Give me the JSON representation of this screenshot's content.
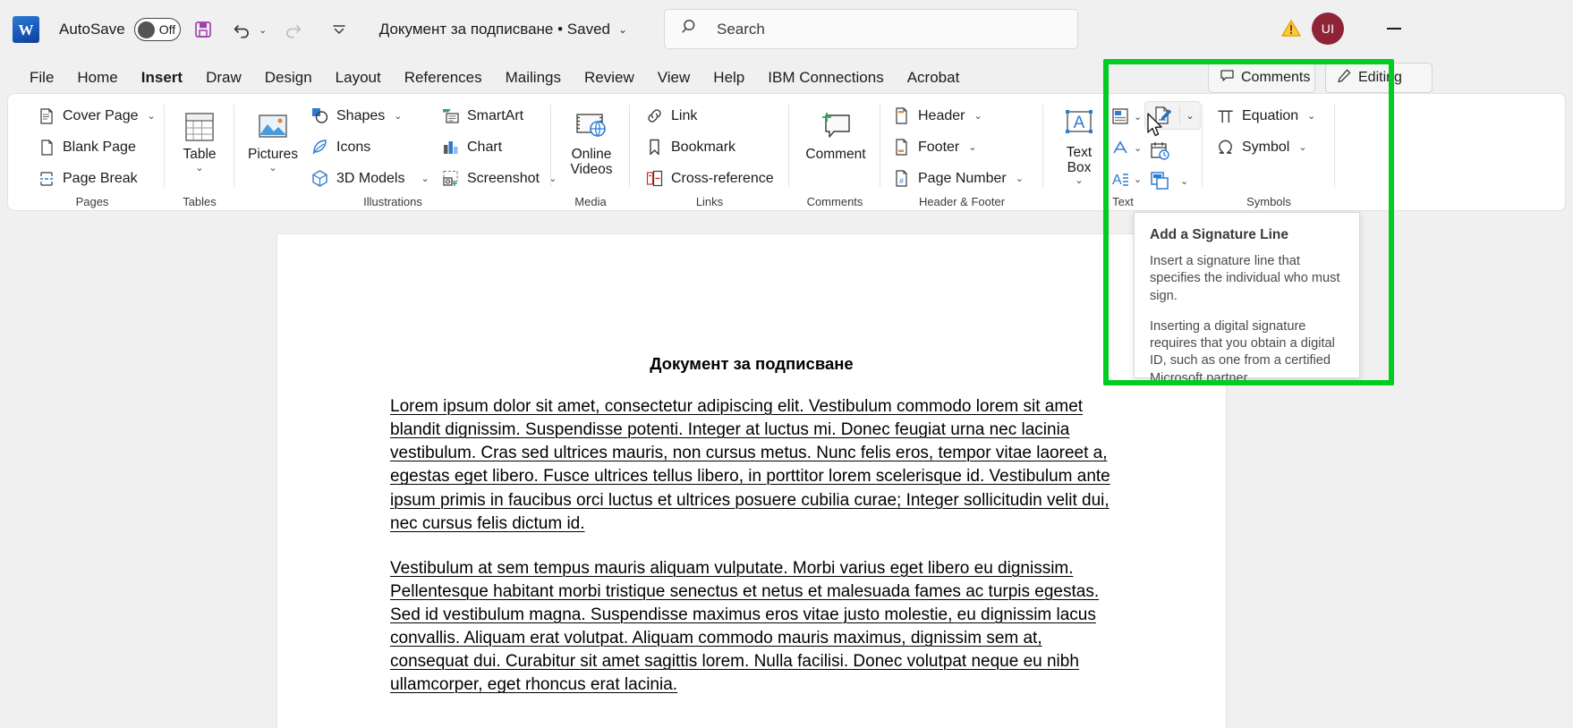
{
  "titlebar": {
    "logo_text": "W",
    "autosave_label": "AutoSave",
    "autosave_state": "Off",
    "save_icon": "save-icon",
    "undo_icon": "undo-icon",
    "redo_icon": "redo-icon",
    "customize_icon": "customize-quick-access-toolbar-icon",
    "document_title": "Документ за подписване • Saved",
    "title_caret": "⌄",
    "warning_icon": "warning-triangle-icon",
    "avatar_initials": "UI",
    "avatar_color": "#8f2439",
    "minimize_label": "—"
  },
  "search": {
    "icon": "search-icon",
    "placeholder": "Search"
  },
  "tabs": [
    {
      "label": "File",
      "active": false
    },
    {
      "label": "Home",
      "active": false
    },
    {
      "label": "Insert",
      "active": true
    },
    {
      "label": "Draw",
      "active": false
    },
    {
      "label": "Design",
      "active": false
    },
    {
      "label": "Layout",
      "active": false
    },
    {
      "label": "References",
      "active": false
    },
    {
      "label": "Mailings",
      "active": false
    },
    {
      "label": "Review",
      "active": false
    },
    {
      "label": "View",
      "active": false
    },
    {
      "label": "Help",
      "active": false
    },
    {
      "label": "IBM Connections",
      "active": false
    },
    {
      "label": "Acrobat",
      "active": false
    }
  ],
  "tab_right_buttons": {
    "comments": {
      "label": "Comments",
      "icon": "comment-icon"
    },
    "editing": {
      "label": "Editing",
      "icon": "pencil-icon"
    }
  },
  "ribbon": {
    "groups": {
      "pages": {
        "label": "Pages",
        "items": [
          {
            "label": "Cover Page",
            "icon": "cover-page-icon",
            "caret": "⌄"
          },
          {
            "label": "Blank Page",
            "icon": "blank-page-icon",
            "caret": ""
          },
          {
            "label": "Page Break",
            "icon": "page-break-icon",
            "caret": ""
          }
        ]
      },
      "tables": {
        "label": "Tables",
        "items": [
          {
            "label": "Table",
            "icon": "table-icon",
            "caret": "⌄"
          }
        ]
      },
      "illustrations": {
        "label": "Illustrations",
        "items": [
          {
            "label": "Pictures",
            "icon": "pictures-icon",
            "caret": "⌄"
          },
          {
            "label": "Shapes",
            "icon": "shapes-icon",
            "caret": "⌄"
          },
          {
            "label": "Icons",
            "icon": "icons-icon",
            "caret": ""
          },
          {
            "label": "3D Models",
            "icon": "3d-models-icon",
            "caret": "⌄"
          },
          {
            "label": "SmartArt",
            "icon": "smartart-icon",
            "caret": ""
          },
          {
            "label": "Chart",
            "icon": "chart-icon",
            "caret": ""
          },
          {
            "label": "Screenshot",
            "icon": "screenshot-icon",
            "caret": "⌄"
          }
        ]
      },
      "media": {
        "label": "Media",
        "items": [
          {
            "label": "Online Videos",
            "icon": "online-videos-icon",
            "caret": ""
          }
        ]
      },
      "links": {
        "label": "Links",
        "items": [
          {
            "label": "Link",
            "icon": "link-icon",
            "caret": ""
          },
          {
            "label": "Bookmark",
            "icon": "bookmark-icon",
            "caret": ""
          },
          {
            "label": "Cross-reference",
            "icon": "cross-reference-icon",
            "caret": ""
          }
        ]
      },
      "comments": {
        "label": "Comments",
        "items": [
          {
            "label": "Comment",
            "icon": "new-comment-icon",
            "caret": ""
          }
        ]
      },
      "header_footer": {
        "label": "Header & Footer",
        "items": [
          {
            "label": "Header",
            "icon": "header-icon",
            "caret": "⌄"
          },
          {
            "label": "Footer",
            "icon": "footer-icon",
            "caret": "⌄"
          },
          {
            "label": "Page Number",
            "icon": "page-number-icon",
            "caret": "⌄"
          }
        ]
      },
      "text": {
        "label": "Text",
        "items": [
          {
            "label": "Text Box",
            "icon": "text-box-icon",
            "caret": "⌄"
          },
          {
            "label": "",
            "icon": "quick-parts-icon",
            "caret": "⌄"
          },
          {
            "label": "",
            "icon": "wordart-icon",
            "caret": "⌄"
          },
          {
            "label": "",
            "icon": "drop-cap-icon",
            "caret": "⌄"
          },
          {
            "label": "",
            "icon": "signature-line-icon",
            "caret": "⌄"
          },
          {
            "label": "",
            "icon": "date-and-time-icon",
            "caret": ""
          },
          {
            "label": "",
            "icon": "object-icon",
            "caret": "⌄"
          }
        ]
      },
      "symbols": {
        "label": "Symbols",
        "items": [
          {
            "label": "Equation",
            "icon": "equation-icon",
            "caret": "⌄"
          },
          {
            "label": "Symbol",
            "icon": "symbol-icon",
            "caret": "⌄"
          }
        ]
      }
    }
  },
  "tooltip": {
    "title": "Add a Signature Line",
    "paragraph1": "Insert a signature line that specifies the individual who must sign.",
    "paragraph2": "Inserting a digital signature requires that you obtain a digital ID, such as one from a certified Microsoft partner."
  },
  "highlight": {
    "color": "#00cc22"
  },
  "document": {
    "heading": "Документ за подписване",
    "paragraphs": [
      "Lorem ipsum dolor sit amet, consectetur adipiscing elit. Vestibulum commodo lorem sit amet blandit dignissim. Suspendisse potenti. Integer at luctus mi. Donec feugiat urna nec lacinia vestibulum. Cras sed ultrices mauris, non cursus metus. Nunc felis eros, tempor vitae laoreet a, egestas eget libero. Fusce ultrices tellus libero, in porttitor lorem scelerisque id. Vestibulum ante ipsum primis in faucibus orci luctus et ultrices posuere cubilia curae; Integer sollicitudin velit dui, nec cursus felis dictum id.",
      "Vestibulum at sem tempus mauris aliquam vulputate. Morbi varius eget libero eu dignissim. Pellentesque habitant morbi tristique senectus et netus et malesuada fames ac turpis egestas. Sed id vestibulum magna. Suspendisse maximus eros vitae justo molestie, eu dignissim lacus convallis. Aliquam erat volutpat. Aliquam commodo mauris maximus, dignissim sem at, consequat dui. Curabitur sit amet sagittis lorem. Nulla facilisi. Donec volutpat neque eu nibh ullamcorper, eget rhoncus erat lacinia."
    ]
  }
}
